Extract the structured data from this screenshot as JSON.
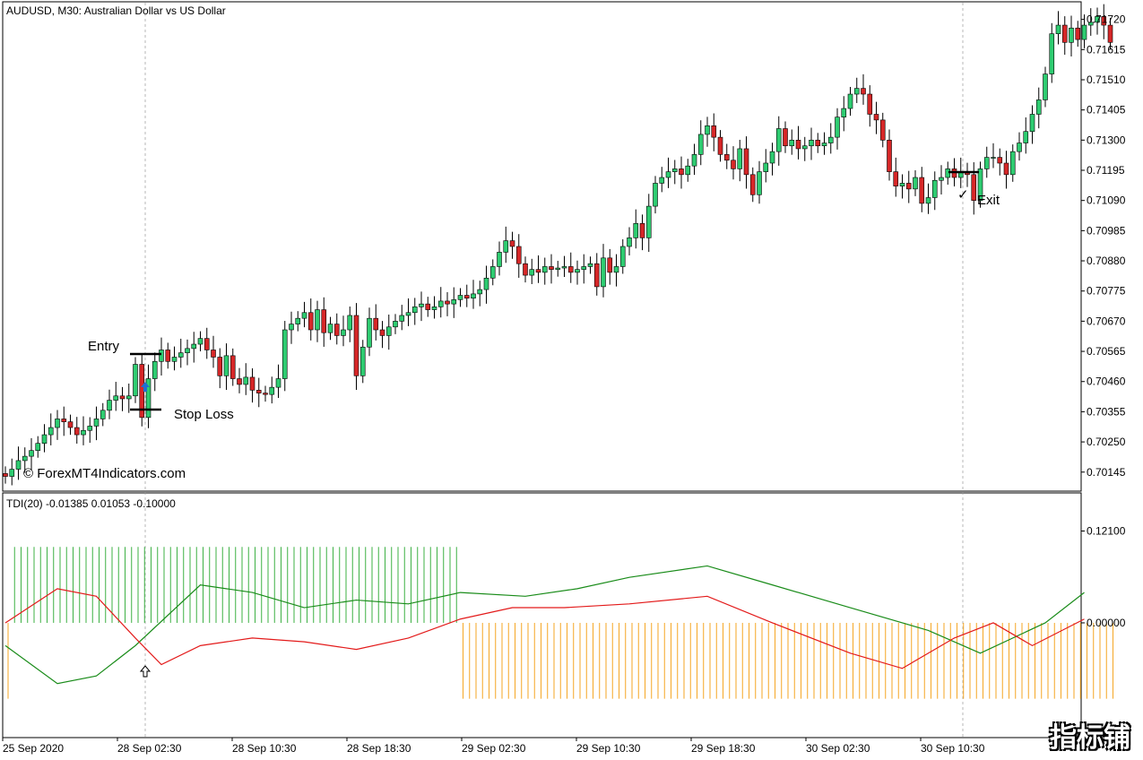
{
  "main_title": "AUDUSD, M30:  Australian Dollar vs US Dollar",
  "indicator_title": "TDI(20) -0.01385 0.01053 -0.10000",
  "copyright": "© ForexMT4Indicators.com",
  "watermark": "指标铺",
  "annotations": {
    "entry": "Entry",
    "stop_loss": "Stop Loss",
    "exit": "Exit",
    "check": "✓"
  },
  "colors": {
    "bull": "#2ecc71",
    "bear": "#d62728",
    "tdi_green": "#1a8c1a",
    "tdi_red": "#e31a1a",
    "hist_pos": "#3cb043",
    "hist_neg": "#f5a623",
    "arrow": "#1f6fd1"
  },
  "chart_data": [
    {
      "type": "candlestick",
      "ylim": [
        0.70085,
        0.71775
      ],
      "y_ticks": [
        "0.71720",
        "0.71615",
        "0.71510",
        "0.71405",
        "0.71300",
        "0.71195",
        "0.71090",
        "0.70985",
        "0.70880",
        "0.70775",
        "0.70670",
        "0.70565",
        "0.70460",
        "0.70355",
        "0.70250",
        "0.70145"
      ],
      "x_labels": [
        "25 Sep 2020",
        "28 Sep 02:30",
        "28 Sep 10:30",
        "28 Sep 18:30",
        "29 Sep 02:30",
        "29 Sep 10:30",
        "29 Sep 18:30",
        "30 Sep 02:30",
        "30 Sep 10:30"
      ],
      "closes": [
        0.7013,
        0.70155,
        0.70185,
        0.702,
        0.7022,
        0.70245,
        0.70275,
        0.703,
        0.7033,
        0.7032,
        0.703,
        0.70275,
        0.7029,
        0.70305,
        0.7033,
        0.7036,
        0.70395,
        0.7041,
        0.704,
        0.7041,
        0.7052,
        0.70335,
        0.7047,
        0.7053,
        0.7057,
        0.7053,
        0.70545,
        0.7056,
        0.70575,
        0.7059,
        0.7061,
        0.7057,
        0.70545,
        0.7048,
        0.7055,
        0.7047,
        0.7045,
        0.70475,
        0.7043,
        0.7042,
        0.70415,
        0.7044,
        0.7047,
        0.7064,
        0.7066,
        0.7068,
        0.707,
        0.7064,
        0.7071,
        0.7063,
        0.7066,
        0.7062,
        0.7064,
        0.7069,
        0.7048,
        0.7058,
        0.7068,
        0.7064,
        0.7062,
        0.7065,
        0.7067,
        0.7069,
        0.707,
        0.7072,
        0.7073,
        0.7071,
        0.7072,
        0.7074,
        0.7073,
        0.70745,
        0.7076,
        0.7075,
        0.70765,
        0.7078,
        0.7082,
        0.7086,
        0.7091,
        0.7095,
        0.7093,
        0.7087,
        0.7083,
        0.7085,
        0.7084,
        0.7086,
        0.7085,
        0.70855,
        0.7086,
        0.7084,
        0.7085,
        0.7086,
        0.7087,
        0.7079,
        0.7089,
        0.7084,
        0.7086,
        0.7093,
        0.7096,
        0.7101,
        0.7096,
        0.7107,
        0.7115,
        0.7117,
        0.7119,
        0.712,
        0.7118,
        0.7121,
        0.7125,
        0.7132,
        0.7135,
        0.7131,
        0.7125,
        0.7123,
        0.712,
        0.7127,
        0.7118,
        0.7111,
        0.7119,
        0.7122,
        0.7126,
        0.7134,
        0.7128,
        0.713,
        0.7127,
        0.7128,
        0.713,
        0.7128,
        0.7129,
        0.7131,
        0.7138,
        0.7141,
        0.7146,
        0.7148,
        0.7146,
        0.7139,
        0.7137,
        0.713,
        0.7119,
        0.7114,
        0.7115,
        0.7113,
        0.7117,
        0.7108,
        0.711,
        0.7116,
        0.7117,
        0.712,
        0.7117,
        0.7119,
        0.7118,
        0.7109,
        0.712,
        0.7124,
        0.7124,
        0.7122,
        0.7118,
        0.7126,
        0.7129,
        0.7133,
        0.7139,
        0.7144,
        0.7153,
        0.7167,
        0.717,
        0.7164,
        0.7169,
        0.7165,
        0.717,
        0.7171,
        0.7173,
        0.717,
        0.7164
      ]
    },
    {
      "type": "line",
      "title": "TDI(20) -0.01385 0.01053 -0.10000",
      "ylim": [
        -0.15,
        0.17
      ],
      "y_ticks": [
        "0.12100",
        "0.00000"
      ],
      "histogram": {
        "positive_until_index": 69,
        "value_pos": 0.1,
        "value_neg": -0.1,
        "first_bar_negative": true
      },
      "series": [
        {
          "color": "green",
          "points": [
            [
              0,
              -0.03
            ],
            [
              8,
              -0.08
            ],
            [
              14,
              -0.07
            ],
            [
              20,
              -0.03
            ],
            [
              30,
              0.05
            ],
            [
              38,
              0.04
            ],
            [
              46,
              0.02
            ],
            [
              54,
              0.03
            ],
            [
              62,
              0.025
            ],
            [
              70,
              0.04
            ],
            [
              80,
              0.035
            ],
            [
              88,
              0.045
            ],
            [
              96,
              0.06
            ],
            [
              108,
              0.075
            ],
            [
              118,
              0.05
            ],
            [
              130,
              0.02
            ],
            [
              142,
              -0.01
            ],
            [
              150,
              -0.04
            ],
            [
              160,
              0.0
            ],
            [
              166,
              0.04
            ]
          ]
        },
        {
          "color": "red",
          "points": [
            [
              0,
              0.0
            ],
            [
              8,
              0.045
            ],
            [
              14,
              0.035
            ],
            [
              20,
              -0.02
            ],
            [
              24,
              -0.055
            ],
            [
              30,
              -0.03
            ],
            [
              38,
              -0.02
            ],
            [
              46,
              -0.025
            ],
            [
              54,
              -0.035
            ],
            [
              62,
              -0.02
            ],
            [
              70,
              0.005
            ],
            [
              78,
              0.02
            ],
            [
              86,
              0.02
            ],
            [
              96,
              0.025
            ],
            [
              108,
              0.035
            ],
            [
              118,
              0.0
            ],
            [
              130,
              -0.04
            ],
            [
              138,
              -0.06
            ],
            [
              146,
              -0.02
            ],
            [
              152,
              0.0
            ],
            [
              158,
              -0.03
            ],
            [
              166,
              0.005
            ]
          ]
        }
      ]
    }
  ]
}
